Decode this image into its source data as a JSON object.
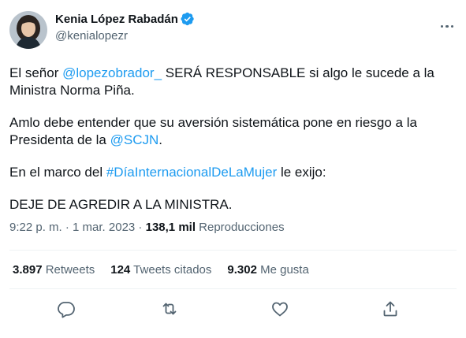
{
  "author": {
    "name": "Kenia López Rabadán",
    "handle": "@kenialopezr",
    "verified_icon": "verified-badge-icon",
    "avatar_icon": "avatar"
  },
  "tweet": {
    "p1_pre": "El señor ",
    "p1_mention": "@lopezobrador_",
    "p1_post": " SERÁ RESPONSABLE si algo le sucede a la Ministra Norma Piña.",
    "p2_pre": "Amlo debe entender que su aversión sistemática pone en riesgo a la Presidenta de la ",
    "p2_mention": "@SCJN",
    "p2_post": ".",
    "p3_pre": "En el marco del ",
    "p3_hashtag": "#DíaInternacionalDeLaMujer",
    "p3_post": " le exijo:",
    "p4": "DEJE DE AGREDIR A LA MINISTRA."
  },
  "meta": {
    "time": "9:22 p. m.",
    "sep1": " · ",
    "date": "1 mar. 2023",
    "sep2": " · ",
    "views_count": "138,1 mil",
    "views_label": " Reproducciones"
  },
  "stats": {
    "retweets_count": "3.897",
    "retweets_label": " Retweets",
    "quotes_count": "124",
    "quotes_label": " Tweets citados",
    "likes_count": "9.302",
    "likes_label": " Me gusta"
  },
  "actions": [
    "reply-icon",
    "retweet-icon",
    "like-icon",
    "share-icon"
  ],
  "colors": {
    "link": "#1d9bf0",
    "text": "#0f1419",
    "secondary": "#536471",
    "divider": "#eff3f4"
  }
}
